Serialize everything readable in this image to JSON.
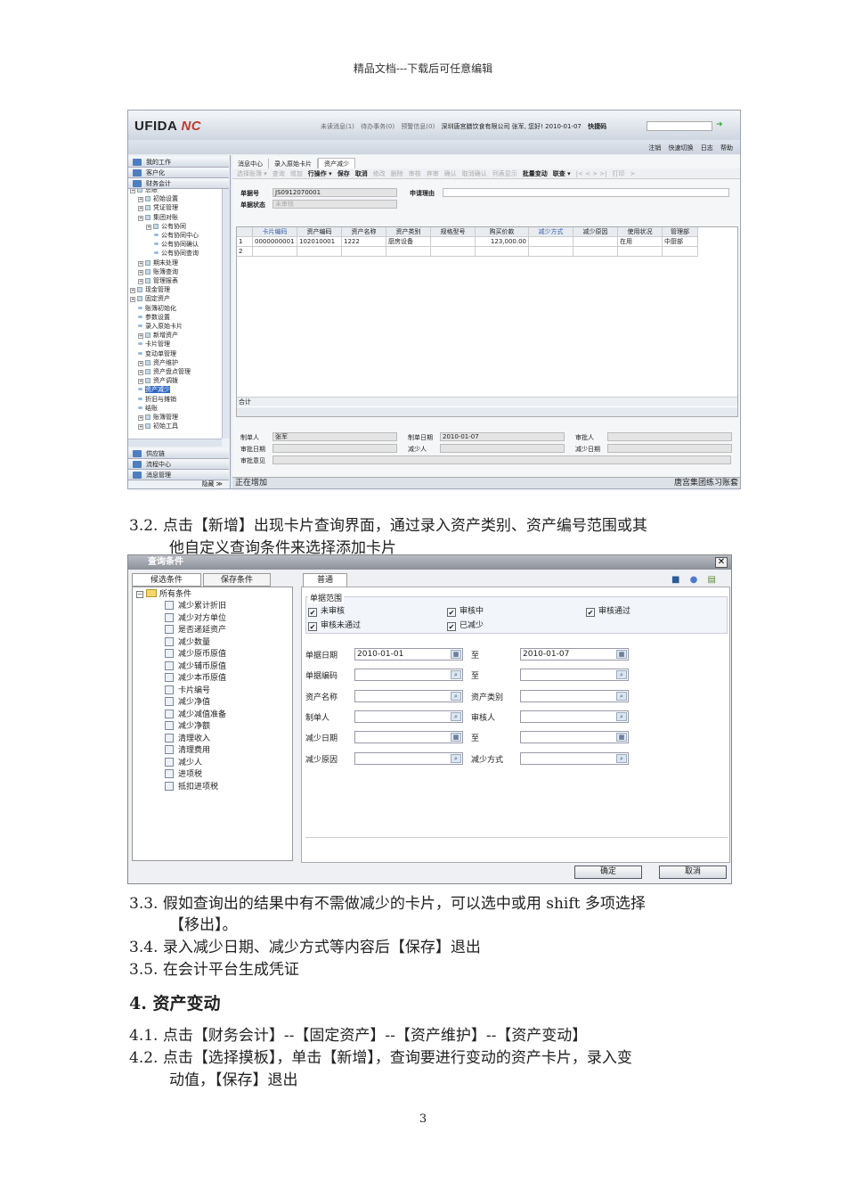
{
  "doc_header": "精品文档---下载后可任意编辑",
  "screenshot1": {
    "logo": "UFIDA NC",
    "top_messages": [
      "未读消息(1)",
      "待办事务(0)",
      "预警信息(0)",
      "深圳唐宫膳饮食有限公司 张军, 您好! 2010-01-07",
      "快捷码"
    ],
    "top_links": [
      "注销",
      "快速切换",
      "日志",
      "帮助"
    ],
    "sections_top": [
      "我的工作",
      "客户化",
      "财务会计"
    ],
    "sections_bottom": [
      "供应链",
      "流程中心",
      "消息管理"
    ],
    "hide_label": "隐藏 ≫",
    "tree": [
      {
        "label": "总账",
        "level": 0,
        "type": "folder"
      },
      {
        "label": "初始设置",
        "level": 1,
        "type": "folder"
      },
      {
        "label": "凭证管理",
        "level": 1,
        "type": "folder"
      },
      {
        "label": "集团对账",
        "level": 1,
        "type": "folder"
      },
      {
        "label": "公有协同",
        "level": 2,
        "type": "folder"
      },
      {
        "label": "公有协同中心",
        "level": 3,
        "type": "leaf"
      },
      {
        "label": "公有协同确认",
        "level": 3,
        "type": "leaf"
      },
      {
        "label": "公有协同查询",
        "level": 3,
        "type": "leaf"
      },
      {
        "label": "期末处理",
        "level": 1,
        "type": "folder"
      },
      {
        "label": "账簿查询",
        "level": 1,
        "type": "folder"
      },
      {
        "label": "管理报表",
        "level": 1,
        "type": "folder"
      },
      {
        "label": "现金管理",
        "level": 0,
        "type": "folder"
      },
      {
        "label": "固定资产",
        "level": 0,
        "type": "folder"
      },
      {
        "label": "账簿初始化",
        "level": 1,
        "type": "leaf"
      },
      {
        "label": "参数设置",
        "level": 1,
        "type": "leaf"
      },
      {
        "label": "录入原始卡片",
        "level": 1,
        "type": "leaf"
      },
      {
        "label": "新增资产",
        "level": 1,
        "type": "folder"
      },
      {
        "label": "卡片管理",
        "level": 1,
        "type": "leaf"
      },
      {
        "label": "变动单管理",
        "level": 1,
        "type": "leaf"
      },
      {
        "label": "资产维护",
        "level": 1,
        "type": "folder"
      },
      {
        "label": "资产盘点管理",
        "level": 1,
        "type": "folder"
      },
      {
        "label": "资产调拨",
        "level": 1,
        "type": "folder"
      },
      {
        "label": "资产减少",
        "level": 1,
        "type": "leaf",
        "selected": true
      },
      {
        "label": "折旧与摊销",
        "level": 1,
        "type": "leaf"
      },
      {
        "label": "结账",
        "level": 1,
        "type": "leaf"
      },
      {
        "label": "账簿管理",
        "level": 1,
        "type": "folder"
      },
      {
        "label": "初始工具",
        "level": 1,
        "type": "folder"
      }
    ],
    "tabs": [
      "消息中心",
      "录入原始卡片",
      "资产减少"
    ],
    "toolbar": [
      {
        "label": "选择账簿 ▾",
        "enabled": false
      },
      {
        "label": "查询",
        "enabled": false
      },
      {
        "label": "增加",
        "enabled": false
      },
      {
        "label": "行操作 ▾",
        "enabled": true
      },
      {
        "label": "保存",
        "enabled": true
      },
      {
        "label": "取消",
        "enabled": true
      },
      {
        "label": "修改",
        "enabled": false
      },
      {
        "label": "删除",
        "enabled": false
      },
      {
        "label": "审核",
        "enabled": false
      },
      {
        "label": "弃审",
        "enabled": false
      },
      {
        "label": "确认",
        "enabled": false
      },
      {
        "label": "取消确认",
        "enabled": false
      },
      {
        "label": "列表显示",
        "enabled": false
      },
      {
        "label": "批量变动",
        "enabled": true
      },
      {
        "label": "联查 ▾",
        "enabled": true
      },
      {
        "label": "|<  <  >  >|",
        "enabled": false
      },
      {
        "label": "打印",
        "enabled": false
      },
      {
        "label": ">",
        "enabled": false
      }
    ],
    "form": {
      "bill_no_label": "单据号",
      "bill_no": "JS0912070001",
      "reason_label": "申请理由",
      "reason": "",
      "status_label": "单据状态",
      "status": "未审核"
    },
    "table": {
      "headers": [
        "",
        "卡片编码",
        "资产编码",
        "资产名称",
        "资产类别",
        "规格型号",
        "购买价款",
        "减少方式",
        "减少原因",
        "使用状况",
        "管理部"
      ],
      "rows": [
        [
          "1",
          "0000000001",
          "102010001",
          "1222",
          "厨房设备",
          "",
          "123,000.00",
          "",
          "",
          "在用",
          "中厨部"
        ],
        [
          "2",
          "",
          "",
          "",
          "",
          "",
          "",
          "",
          "",
          "",
          ""
        ]
      ],
      "total_label": "合计"
    },
    "footer_form": [
      {
        "label": "制单人",
        "value": "张军"
      },
      {
        "label": "制单日期",
        "value": "2010-01-07"
      },
      {
        "label": "审批人",
        "value": ""
      },
      {
        "label": "审批日期",
        "value": ""
      },
      {
        "label": "减少人",
        "value": ""
      },
      {
        "label": "减少日期",
        "value": ""
      },
      {
        "label": "审批意见",
        "value": ""
      }
    ],
    "status_left": "正在增加",
    "status_right": "唐宫集团练习账套"
  },
  "text_3_2": [
    "3.2. 点击【新增】出现卡片查询界面，通过录入资产类别、资产编号范围或其",
    "他自定义查询条件来选择添加卡片"
  ],
  "screenshot2": {
    "title": "查询条件",
    "close": "✕",
    "left_tabs": [
      "候选条件",
      "保存条件"
    ],
    "root": "所有条件",
    "conditions": [
      "减少累计折旧",
      "减少对方单位",
      "是否递延资产",
      "减少数量",
      "减少原币原值",
      "减少辅币原值",
      "减少本币原值",
      "卡片编号",
      "减少净值",
      "减少减值准备",
      "减少净额",
      "清理收入",
      "清理费用",
      "减少人",
      "进项税",
      "抵扣进项税"
    ],
    "right_tab": "普通",
    "group_title": "单据范围",
    "checkboxes": [
      {
        "label": "未审核",
        "checked": true
      },
      {
        "label": "审核中",
        "checked": true
      },
      {
        "label": "审核通过",
        "checked": true
      },
      {
        "label": "审核未通过",
        "checked": true
      },
      {
        "label": "已减少",
        "checked": true
      }
    ],
    "fields": [
      {
        "label": "单据日期",
        "value": "2010-01-01",
        "btn": "cal",
        "label2": "至",
        "value2": "2010-01-07",
        "btn2": "cal"
      },
      {
        "label": "单据编码",
        "value": "",
        "btn": "search",
        "label2": "至",
        "value2": "",
        "btn2": "search"
      },
      {
        "label": "资产名称",
        "value": "",
        "btn": "search",
        "label2": "资产类别",
        "value2": "",
        "btn2": "search"
      },
      {
        "label": "制单人",
        "value": "",
        "btn": "search",
        "label2": "审核人",
        "value2": "",
        "btn2": "search"
      },
      {
        "label": "减少日期",
        "value": "",
        "btn": "cal",
        "label2": "至",
        "value2": "",
        "btn2": "cal"
      },
      {
        "label": "减少原因",
        "value": "",
        "btn": "search",
        "label2": "减少方式",
        "value2": "",
        "btn2": "search"
      }
    ],
    "ok": "确定",
    "cancel": "取消"
  },
  "text_3_3": [
    "3.3. 假如查询出的结果中有不需做减少的卡片，可以选中或用 shift 多项选择",
    "【移出】。"
  ],
  "text_3_4": "3.4. 录入减少日期、减少方式等内容后【保存】退出",
  "text_3_5": "3.5. 在会计平台生成凭证",
  "heading_4": "4.  资产变动",
  "text_4_1": "4.1. 点击【财务会计】--【固定资产】--【资产维护】--【资产变动】",
  "text_4_2": [
    "4.2. 点击【选择摸板】，单击【新增】，查询要进行变动的资产卡片，录入变",
    "动值，【保存】退出"
  ],
  "page_number": "3"
}
